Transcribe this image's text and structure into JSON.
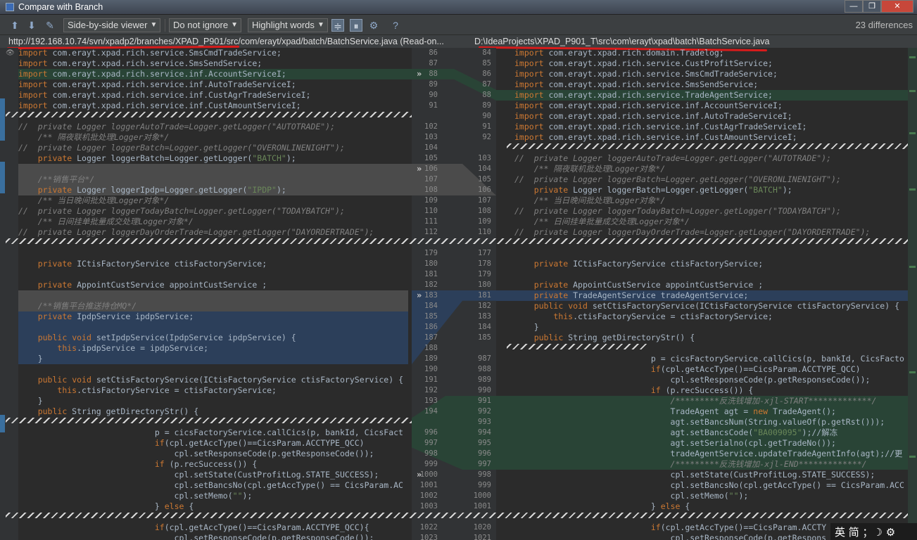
{
  "window": {
    "title": "Compare with Branch"
  },
  "toolbar": {
    "viewer": "Side-by-side viewer",
    "ignore": "Do not ignore",
    "highlight": "Highlight words",
    "differences": "23 differences"
  },
  "paths": {
    "left": "http://192.168.10.74/svn/xpadp2/branches/XPAD_P901/src/com/erayt/xpad/batch/BatchService.java (Read-on...",
    "right": "D:\\IdeaProjects\\XPAD_P901_T\\src\\com\\erayt\\xpad\\batch\\BatchService.java"
  },
  "left_lines": [
    "import com.erayt.xpad.rich.service.SmsCmdTradeService;",
    "import com.erayt.xpad.rich.service.SmsSendService;",
    "import com.erayt.xpad.rich.service.inf.AccountServiceI;",
    "import com.erayt.xpad.rich.service.inf.AutoTradeServiceI;",
    "import com.erayt.xpad.rich.service.inf.CustAgrTradeServiceI;",
    "import com.erayt.xpad.rich.service.inf.CustAmountServiceI;",
    "//  private Logger loggerAutoTrade=Logger.getLogger(\"AUTOTRADE\");",
    "    /** 隔夜联机批处理Logger对象*/",
    "//  private Logger loggerBatch=Logger.getLogger(\"OVERONLINENIGHT\");",
    "    private Logger loggerBatch=Logger.getLogger(\"BATCH\");",
    "",
    "    /**销售平台*/",
    "    private Logger loggerIpdp=Logger.getLogger(\"IPDP\");",
    "    /** 当日晚间批处理Logger对象*/",
    "//  private Logger loggerTodayBatch=Logger.getLogger(\"TODAYBATCH\");",
    "    /** 日间挂单批量成交处理Logger对象*/",
    "//  private Logger loggerDayOrderTrade=Logger.getLogger(\"DAYORDERTRADE\");",
    "",
    "    private ICtisFactoryService ctisFactoryService;",
    "",
    "    private AppointCustService appointCustService ;",
    "",
    "    /**销售平台推送持仓MQ*/",
    "    private IpdpService ipdpService;",
    "",
    "    public void setIpdpService(IpdpService ipdpService) {",
    "        this.ipdpService = ipdpService;",
    "    }",
    "",
    "    public void setCtisFactoryService(ICtisFactoryService ctisFactoryService) {",
    "        this.ctisFactoryService = ctisFactoryService;",
    "    }",
    "    public String getDirectoryStr() {",
    "                            p = cicsFactoryService.callCics(p, bankId, CicsFact",
    "                            if(cpl.getAccType()==CicsParam.ACCTYPE_QCC)",
    "                                cpl.setResponseCode(p.getResponseCode());",
    "                            if (p.recSuccess()) {",
    "                                cpl.setState(CustProfitLog.STATE_SUCCESS);",
    "                                cpl.setBancsNo(cpl.getAccType() == CicsParam.AC",
    "                                cpl.setMemo(\"\");",
    "                            } else {",
    "                            if(cpl.getAccType()==CicsParam.ACCTYPE_QCC){",
    "                                cpl.setResponseCode(p.getResponseCode());"
  ],
  "left_nums": [
    "86",
    "87",
    "88",
    "89",
    "90",
    "91",
    "102",
    "103",
    "104",
    "105",
    "106",
    "107",
    "108",
    "109",
    "110",
    "111",
    "112",
    "179",
    "180",
    "181",
    "182",
    "183",
    "184",
    "185",
    "186",
    "187",
    "188",
    "189",
    "190",
    "191",
    "192",
    "193",
    "194",
    "996",
    "997",
    "998",
    "999",
    "1000",
    "1001",
    "1002",
    "1003",
    "1022",
    "1023"
  ],
  "right_lines": [
    "import com.erayt.xpad.rich.domain.Tradelog;",
    "import com.erayt.xpad.rich.service.CustProfitService;",
    "import com.erayt.xpad.rich.service.SmsCmdTradeService;",
    "import com.erayt.xpad.rich.service.SmsSendService;",
    "import com.erayt.xpad.rich.service.TradeAgentService;",
    "import com.erayt.xpad.rich.service.inf.AccountServiceI;",
    "import com.erayt.xpad.rich.service.inf.AutoTradeServiceI;",
    "import com.erayt.xpad.rich.service.inf.CustAgrTradeServiceI;",
    "import com.erayt.xpad.rich.service.inf.CustAmountServiceI;",
    "//  private Logger loggerAutoTrade=Logger.getLogger(\"AUTOTRADE\");",
    "    /** 隔夜联机批处理Logger对象*/",
    "//  private Logger loggerBatch=Logger.getLogger(\"OVERONLINENIGHT\");",
    "    private Logger loggerBatch=Logger.getLogger(\"BATCH\");",
    "    /** 当日晚间批处理Logger对象*/",
    "//  private Logger loggerTodayBatch=Logger.getLogger(\"TODAYBATCH\");",
    "    /** 日间挂单批量成交处理Logger对象*/",
    "//  private Logger loggerDayOrderTrade=Logger.getLogger(\"DAYORDERTRADE\");",
    "",
    "    private ICtisFactoryService ctisFactoryService;",
    "",
    "    private AppointCustService appointCustService ;",
    "    private TradeAgentService tradeAgentService;",
    "    public void setCtisFactoryService(ICtisFactoryService ctisFactoryService) {",
    "        this.ctisFactoryService = ctisFactoryService;",
    "    }",
    "    public String getDirectoryStr() {",
    "                            p = cicsFactoryService.callCics(p, bankId, CicsFacto",
    "                            if(cpl.getAccType()==CicsParam.ACCTYPE_QCC)",
    "                                cpl.setResponseCode(p.getResponseCode());",
    "                            if (p.recSuccess()) {",
    "                                /*********反洗钱增加-xjl-START*************/",
    "                                TradeAgent agt = new TradeAgent();",
    "                                agt.setBancsNum(String.valueOf(p.getRst()));",
    "                                agt.setBancsCode(\"BA009095\");//解冻",
    "                                agt.setSerialno(cpl.getTradeNo());",
    "                                tradeAgentService.updateTradeAgentInfo(agt);//更",
    "                                /*********反洗钱增加-xjl-END*************/",
    "                                cpl.setState(CustProfitLog.STATE_SUCCESS);",
    "                                cpl.setBancsNo(cpl.getAccType() == CicsParam.ACC",
    "                                cpl.setMemo(\"\");",
    "                            } else {",
    "                            if(cpl.getAccType()==CicsParam.ACCTY",
    "                                cpl.setResponseCode(p.getRespons"
  ],
  "right_nums": [
    "84",
    "85",
    "86",
    "87",
    "88",
    "89",
    "90",
    "91",
    "92",
    "103",
    "104",
    "105",
    "106",
    "107",
    "108",
    "109",
    "110",
    "177",
    "178",
    "179",
    "180",
    "181",
    "182",
    "183",
    "184",
    "185",
    "987",
    "988",
    "989",
    "990",
    "991",
    "992",
    "993",
    "994",
    "995",
    "996",
    "997",
    "998",
    "999",
    "1000",
    "1001",
    "1020",
    "1021"
  ],
  "ime": {
    "text": "英 简 ；☽ ⚙"
  }
}
